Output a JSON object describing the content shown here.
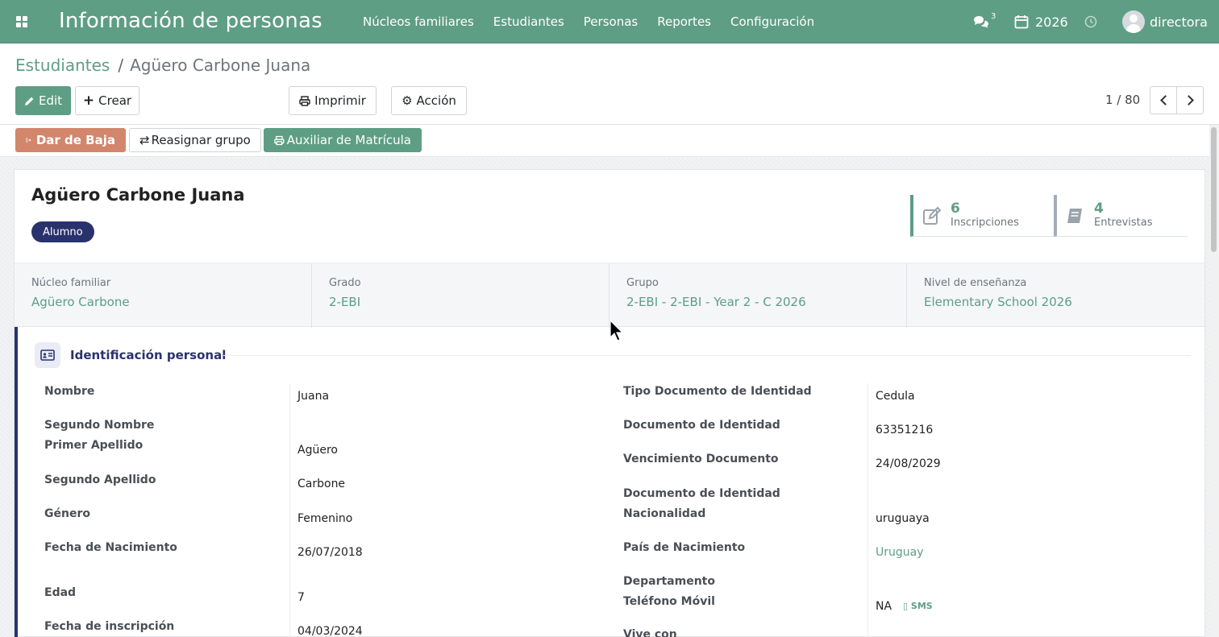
{
  "navbar": {
    "app_title": "Información de personas",
    "menu": [
      "Núcleos familiares",
      "Estudiantes",
      "Personas",
      "Reportes",
      "Configuración"
    ],
    "chat_count": "3",
    "year": "2026",
    "user": "directora",
    "bg_color": "#5e9e84"
  },
  "breadcrumb": {
    "parent": "Estudiantes",
    "separator": "/",
    "current": "Agüero Carbone Juana"
  },
  "actions": {
    "edit": "Edit",
    "create": "Crear",
    "print": "Imprimir",
    "action": "Acción"
  },
  "pager": {
    "value": "1 / 80"
  },
  "statusbar": {
    "unsubscribe": "Dar de Baja",
    "reassign": "Reasignar grupo",
    "aux": "Auxiliar de Matrícula"
  },
  "record": {
    "title": "Agüero Carbone Juana",
    "tag": "Alumno",
    "stats": [
      {
        "value": "6",
        "label": "Inscripciones"
      },
      {
        "value": "4",
        "label": "Entrevistas"
      }
    ]
  },
  "info_band": [
    {
      "label": "Núcleo familiar",
      "value": "Agüero Carbone"
    },
    {
      "label": "Grado",
      "value": "2-EBI"
    },
    {
      "label": "Grupo",
      "value": "2-EBI - 2-EBI - Year 2 - C 2026"
    },
    {
      "label": "Nivel de enseñanza",
      "value": "Elementary School 2026"
    }
  ],
  "section": {
    "title": "Identificación personal",
    "left": [
      {
        "label": "Nombre",
        "value": "Juana"
      },
      {
        "label": "Segundo Nombre",
        "value": ""
      },
      {
        "label": "Primer Apellido",
        "value": "Agüero"
      },
      {
        "label": "Segundo Apellido",
        "value": "Carbone"
      },
      {
        "label": "Género",
        "value": "Femenino"
      },
      {
        "label": "Fecha de Nacimiento",
        "value": "26/07/2018"
      },
      {
        "label": "Edad",
        "value": "7"
      },
      {
        "label": "Fecha de inscripción",
        "value": "04/03/2024"
      }
    ],
    "right": [
      {
        "label": "Tipo Documento de Identidad",
        "value": "Cedula"
      },
      {
        "label": "Documento de Identidad",
        "value": "63351216"
      },
      {
        "label": "Vencimiento Documento",
        "value": "24/08/2029"
      },
      {
        "label": "Documento de Identidad",
        "value": ""
      },
      {
        "label": "Nacionalidad",
        "value": "uruguaya"
      },
      {
        "label": "País de Nacimiento",
        "value": "Uruguay"
      },
      {
        "label": "Departamento",
        "value": ""
      },
      {
        "label": "Teléfono Móvil",
        "value": "NA"
      },
      {
        "label": "Vive con",
        "value": ""
      }
    ],
    "sms_label": "SMS"
  }
}
